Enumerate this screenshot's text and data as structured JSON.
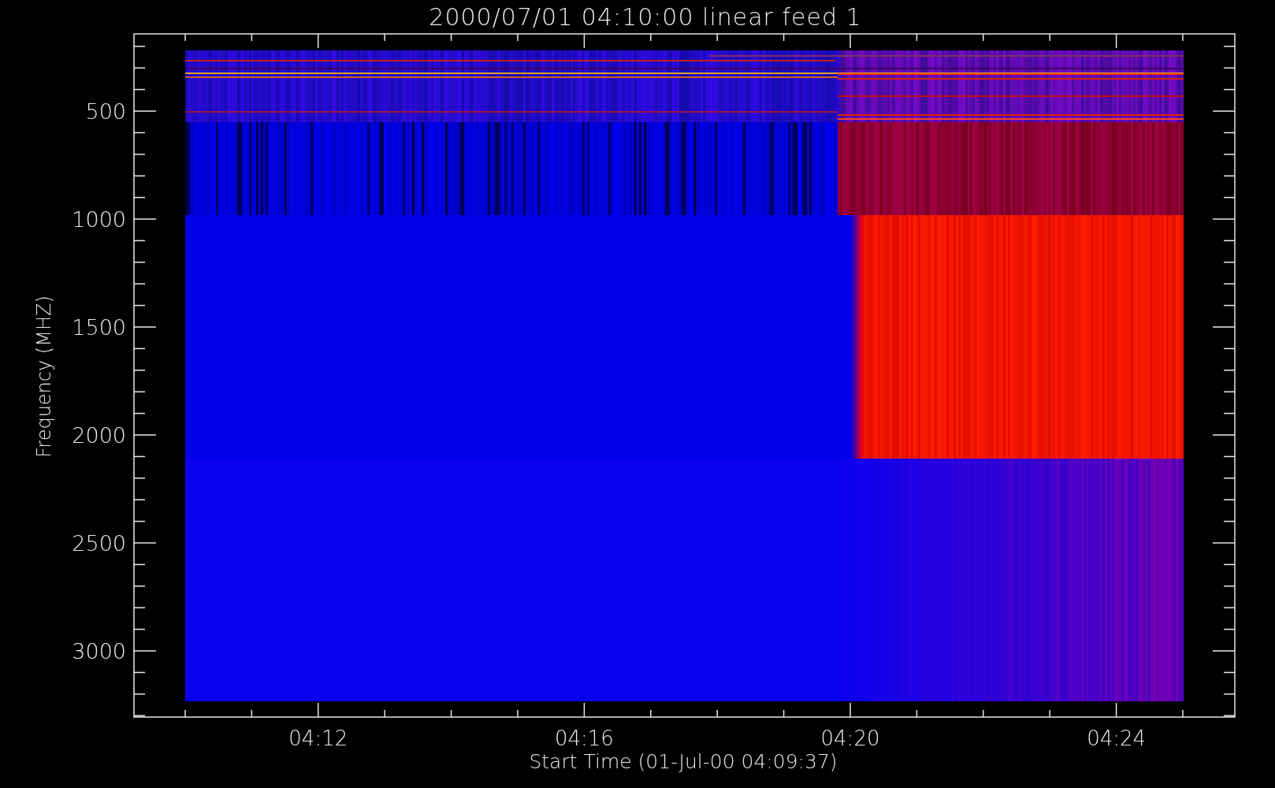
{
  "plot": {
    "title": "2000/07/01 04:10:00 linear feed 1",
    "ylabel": "Frequency (MHZ)",
    "xlabel": "Start Time (01-Jul-00 04:09:37)",
    "yticks": [
      "500",
      "1000",
      "1500",
      "2000",
      "2500",
      "3000"
    ],
    "xticks": [
      "04:12",
      "04:16",
      "04:20",
      "04:24"
    ]
  }
}
